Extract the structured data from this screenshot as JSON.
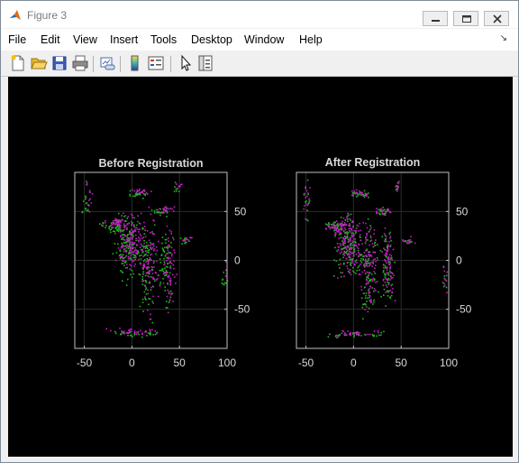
{
  "window": {
    "title": "Figure 3"
  },
  "menu": [
    "File",
    "Edit",
    "View",
    "Insert",
    "Tools",
    "Desktop",
    "Window",
    "Help"
  ],
  "toolbar": [
    "new-figure-icon",
    "open-file-icon",
    "save-icon",
    "print-icon",
    "link-plot-icon",
    "insert-colorbar-icon",
    "insert-legend-icon",
    "edit-plot-icon",
    "property-inspector-icon"
  ],
  "colors": {
    "series_a": "#22b522",
    "series_b": "#c21ec2",
    "figure_bg": "#000000",
    "axis": "#bfbfbf"
  },
  "chart_data": [
    {
      "type": "scatter",
      "title": "Before Registration",
      "xticks": [
        "-50",
        "0",
        "50",
        "100"
      ],
      "yticks": [
        "50",
        "0",
        "-50"
      ],
      "xlim": [
        -60,
        100
      ],
      "ylim": [
        -90,
        90
      ],
      "grid": true,
      "series": [
        {
          "color": "#22b522",
          "values": []
        },
        {
          "color": "#c21ec2",
          "values": []
        }
      ]
    },
    {
      "type": "scatter",
      "title": "After Registration",
      "xticks": [
        "-50",
        "0",
        "50",
        "100"
      ],
      "yticks": [
        "50",
        "0",
        "-50"
      ],
      "xlim": [
        -60,
        100
      ],
      "ylim": [
        -90,
        90
      ],
      "grid": true,
      "series": [
        {
          "color": "#22b522",
          "values": []
        },
        {
          "color": "#c21ec2",
          "values": []
        }
      ]
    }
  ]
}
